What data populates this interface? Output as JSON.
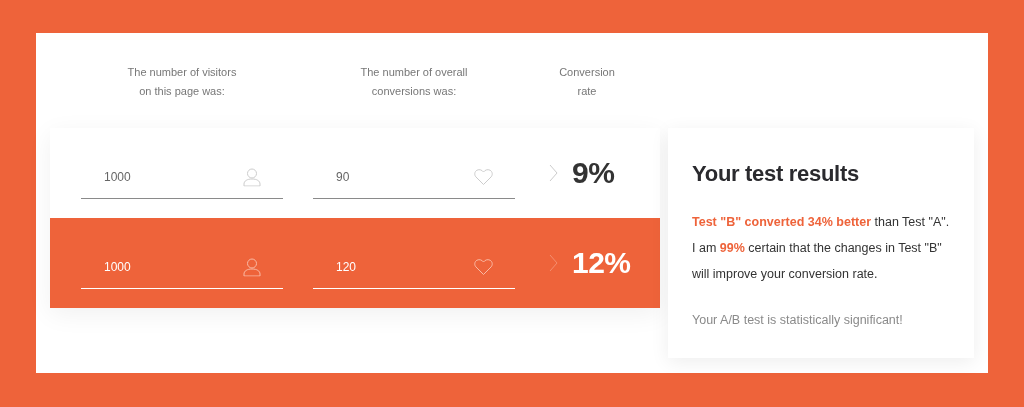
{
  "headers": [
    "The number of visitors\non this page was:",
    "The number of overall\nconversions was:",
    "Conversion\nrate"
  ],
  "rows": [
    {
      "visitors": "1000",
      "conversions": "90",
      "rate": "9%",
      "highlighted": false
    },
    {
      "visitors": "1000",
      "conversions": "120",
      "rate": "12%",
      "highlighted": true
    }
  ],
  "results": {
    "title": "Your test results",
    "sentences": [
      "**Test \"B\" converted 34% better** than Test \"A\".",
      "I am **99%** certain that the changes in Test \"B\" will improve your conversion rate."
    ],
    "note": "Your A/B test is statistically significant!"
  }
}
